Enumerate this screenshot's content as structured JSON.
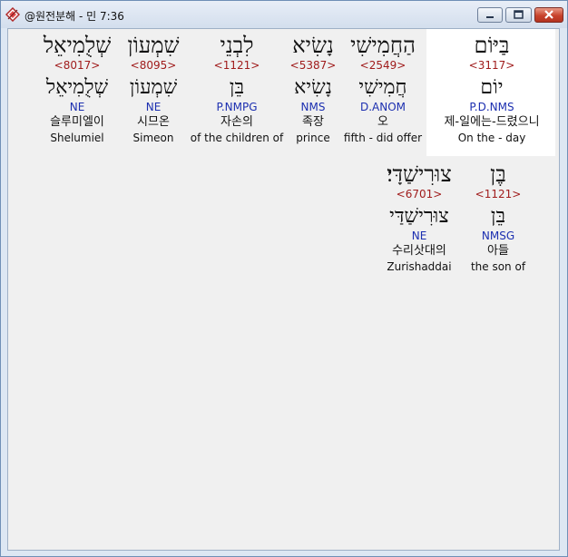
{
  "window": {
    "title": "@원전분해 - 민 7:36",
    "buttons": [
      "minimize",
      "maximize",
      "close"
    ]
  },
  "icons": {
    "app": "app-diamond-icon",
    "minimize": "minimize-icon",
    "maximize": "maximize-icon",
    "close": "close-icon"
  },
  "colors": {
    "strong_number": "#a01c1c",
    "morphology": "#1c2fb0",
    "highlight": "#ffffff"
  },
  "words": [
    {
      "hebrew": "בַּיּוֹם",
      "strong": "<3117>",
      "lemma": "יוֹם",
      "morph": "P.D.NMS",
      "korean": "제-일에는-드렸으니",
      "english": "On the - day",
      "highlighted": true
    },
    {
      "hebrew": "הַחֲמִישִׁי",
      "strong": "<2549>",
      "lemma": "חֲמִישִׁי",
      "morph": "D.ANOM",
      "korean": "오",
      "english": "fifth - did offer",
      "highlighted": false
    },
    {
      "hebrew": "נָשִׂיא",
      "strong": "<5387>",
      "lemma": "נָשִׂיא",
      "morph": "NMS",
      "korean": "족장",
      "english": "prince",
      "highlighted": false
    },
    {
      "hebrew": "לִבְנֵי",
      "strong": "<1121>",
      "lemma": "בֵּן",
      "morph": "P.NMPG",
      "korean": "자손의",
      "english": "of the children of",
      "highlighted": false
    },
    {
      "hebrew": "שִׁמְעוֹן",
      "strong": "<8095>",
      "lemma": "שִׁמְעוֹן",
      "morph": "NE",
      "korean": "시므온",
      "english": "Simeon",
      "highlighted": false
    },
    {
      "hebrew": "שְׁלֻמִיאֵל",
      "strong": "<8017>",
      "lemma": "שְׁלֻמִיאֵל",
      "morph": "NE",
      "korean": "슬루미엘이",
      "english": "Shelumiel",
      "highlighted": false
    },
    {
      "hebrew": "בֶּן",
      "strong": "<1121>",
      "lemma": "בֵּן",
      "morph": "NMSG",
      "korean": "아들",
      "english": "the son of",
      "highlighted": false
    },
    {
      "hebrew": "צוּרִישַׁדָּי׃",
      "strong": "<6701>",
      "lemma": "צוּרִישַׁדַּי",
      "morph": "NE",
      "korean": "수리삿대의",
      "english": "Zurishaddai",
      "highlighted": false
    }
  ]
}
